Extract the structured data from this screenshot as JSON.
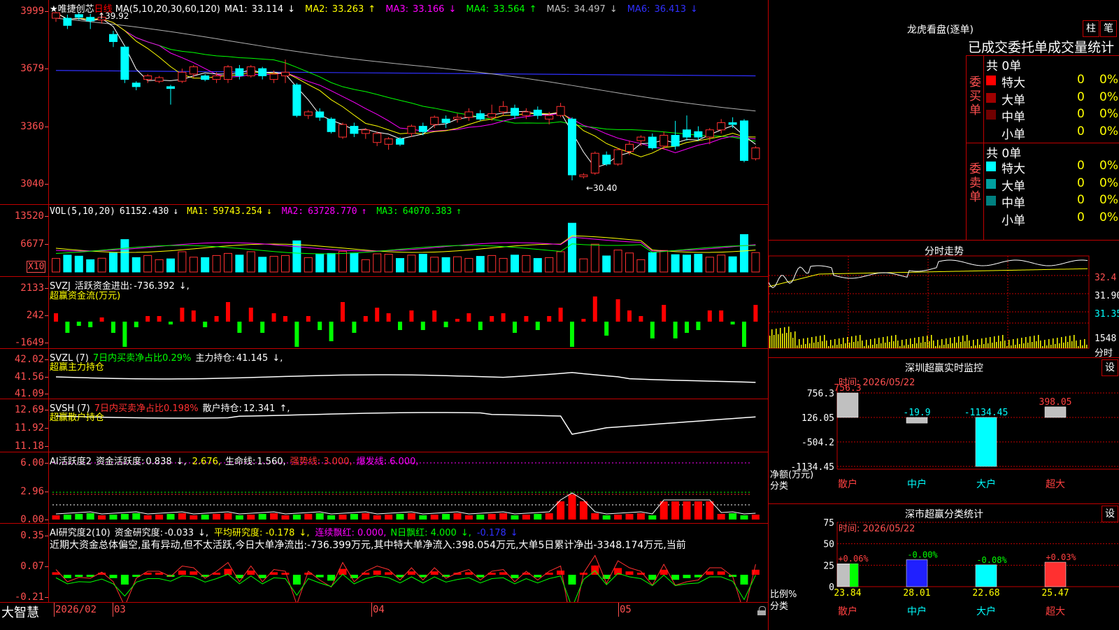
{
  "main": {
    "star": "★",
    "stock_name": "唯捷创芯",
    "period": "日线",
    "ma_label": "MA(5,10,20,30,60,120)",
    "ma": [
      {
        "label": "MA1:",
        "value": "33.114",
        "arrow": "↓",
        "color": "#ffffff"
      },
      {
        "label": "MA2:",
        "value": "33.263",
        "arrow": "↑",
        "color": "#ffff00"
      },
      {
        "label": "MA3:",
        "value": "33.166",
        "arrow": "↓",
        "color": "#ff00ff"
      },
      {
        "label": "MA4:",
        "value": "33.564",
        "arrow": "↑",
        "color": "#00ff00"
      },
      {
        "label": "MA5:",
        "value": "34.497",
        "arrow": "↓",
        "color": "#c0c0c0"
      },
      {
        "label": "MA6:",
        "value": "36.413",
        "arrow": "↓",
        "color": "#3030ff"
      }
    ],
    "yticks": [
      "3999",
      "3679",
      "3360",
      "3040"
    ],
    "high_label": "39.92",
    "low_label": "←30.40"
  },
  "vol": {
    "label": "VOL(5,10,20)",
    "value": "61152.430",
    "value_arrow": "↓",
    "ma": [
      {
        "label": "MA1:",
        "value": "59743.254",
        "arrow": "↓",
        "color": "#ffff00"
      },
      {
        "label": "MA2:",
        "value": "63728.770",
        "arrow": "↑",
        "color": "#ff00ff"
      },
      {
        "label": "MA3:",
        "value": "64070.383",
        "arrow": "↑",
        "color": "#00ff00"
      }
    ],
    "yticks": [
      "13520",
      "6677"
    ],
    "unit": "X10"
  },
  "svzj": {
    "label": "SVZJ",
    "desc": "活跃资金进出:",
    "value": "-736.392",
    "arrow": "↓,",
    "subtitle": "超赢资金流(万元)",
    "yticks": [
      "2133",
      "242",
      "-1649"
    ]
  },
  "svzl": {
    "label": "SVZL (7)",
    "desc": "7日内买卖净占比0.29%",
    "desc2": "主力持仓:",
    "value": "41.145",
    "arrow": "↓,",
    "subtitle": "超赢主力持仓",
    "yticks": [
      "42.02",
      "41.56",
      "41.09"
    ]
  },
  "svsh": {
    "label": "SVSH (7)",
    "desc": "7日内买卖净占比0.198%",
    "desc2": "散户持仓:",
    "value": "12.341",
    "arrow": "↑,",
    "subtitle": "超赢散户持仓",
    "yticks": [
      "12.69",
      "11.92",
      "11.18"
    ]
  },
  "ai": {
    "label": "AI活跃度2",
    "desc": "资金活跃度:",
    "v1": "0.838",
    "a1": "↓,",
    "v2": "2.676,",
    "life_label": "生命线:",
    "life": "1.560,",
    "strong": "强势线: 3.000,",
    "burst": "爆发线: 6.000,",
    "yticks": [
      "6.00",
      "2.96",
      "0.00"
    ]
  },
  "research": {
    "label": "AI研究度2(10)",
    "desc": "资金研究度:",
    "v1": "-0.033",
    "a1": "↓,",
    "avg": "平均研究度: -0.178",
    "avg_arrow": "↓,",
    "red": "连续飘红: 0.000,",
    "nred": "N日飘红: 4.000",
    "nred_arrow": "↓,",
    "last": "-0.178",
    "last_arrow": "↓",
    "comment": "近期大资金总体偏空,虽有异动,但不太活跃,今日大单净流出:-736.399万元,其中特大单净流入:398.054万元,大单5日累计净出-3348.174万元,当前",
    "yticks": [
      "0.35",
      "0.07",
      "-0.21"
    ]
  },
  "bottom": {
    "brand": "大智慧",
    "dates": [
      "2026/02",
      "03",
      "04",
      "05"
    ]
  },
  "dragon": {
    "title": "龙虎看盘(逐单)",
    "btn1": "柱",
    "btn2": "笔",
    "subtitle": "已成交委托单成交量统计",
    "buy_label": "委买单",
    "sell_label": "委卖单",
    "buy_total": "共 0单",
    "sell_total": "共 0单",
    "buy_rows": [
      {
        "name": "特大",
        "count": "0",
        "pct": "0%",
        "color": "#ff0000"
      },
      {
        "name": "大单",
        "count": "0",
        "pct": "0%",
        "color": "#a00000"
      },
      {
        "name": "中单",
        "count": "0",
        "pct": "0%",
        "color": "#700000"
      },
      {
        "name": "小单",
        "count": "0",
        "pct": "0%",
        "color": "#000000"
      }
    ],
    "sell_rows": [
      {
        "name": "特大",
        "count": "0",
        "pct": "0%",
        "color": "#00ffff"
      },
      {
        "name": "大单",
        "count": "0",
        "pct": "0%",
        "color": "#00a0a0"
      },
      {
        "name": "中单",
        "count": "0",
        "pct": "0%",
        "color": "#008080"
      },
      {
        "name": "小单",
        "count": "0",
        "pct": "0%",
        "color": "#000000"
      }
    ]
  },
  "intraday": {
    "title": "分时走势",
    "yticks": [
      "32.4",
      "31.90",
      "31.35"
    ],
    "vol_tick": "1548",
    "vol_label": "分时"
  },
  "monitor": {
    "title": "深圳超赢实时监控",
    "btn": "设",
    "time": "时间: 2026/05/22",
    "yticks": [
      "756.3",
      "126.05",
      "-504.2",
      "-1134.45"
    ],
    "unit": "净额(万元)",
    "axis_label": "分类",
    "categories": [
      "散户",
      "中户",
      "大户",
      "超大"
    ],
    "values": [
      756.3,
      -19.9,
      -1134.45,
      398.05
    ],
    "value_labels": [
      "756.3",
      "-19.9",
      "-1134.45",
      "398.05"
    ]
  },
  "classify": {
    "title": "深市超赢分类统计",
    "btn": "设",
    "time": "时间: 2026/05/22",
    "yticks": [
      "75",
      "50",
      "25",
      "0"
    ],
    "unit": "比例%",
    "axis_label": "分类",
    "categories": [
      "散户",
      "中户",
      "大户",
      "超大"
    ],
    "values": [
      23.84,
      28.01,
      22.68,
      25.47
    ],
    "changes": [
      "+0.06%",
      "-0.00%",
      "-0.08%",
      "+0.03%"
    ],
    "change_colors": [
      "#ff4040",
      "#00ff00",
      "#00ff00",
      "#ff4040"
    ],
    "bar_colors": [
      "#c0c0c0",
      "#2020ff",
      "#00ffff",
      "#ff3030"
    ]
  },
  "chart_data": {
    "type": "candlestick",
    "ylim": [
      3040,
      3999
    ],
    "candles": [
      [
        3960,
        3990,
        3940,
        3995
      ],
      [
        3960,
        3920,
        3900,
        3980
      ],
      [
        3980,
        3965,
        3950,
        3995
      ],
      [
        3965,
        3945,
        3900,
        3985
      ],
      [
        3950,
        3965,
        3930,
        3990
      ],
      [
        3870,
        3830,
        3800,
        3890
      ],
      [
        3800,
        3620,
        3600,
        3810
      ],
      [
        3600,
        3580,
        3560,
        3610
      ],
      [
        3620,
        3640,
        3600,
        3650
      ],
      [
        3610,
        3630,
        3600,
        3640
      ],
      [
        3580,
        3570,
        3480,
        3590
      ],
      [
        3610,
        3660,
        3600,
        3680
      ],
      [
        3650,
        3690,
        3630,
        3700
      ],
      [
        3640,
        3620,
        3610,
        3650
      ],
      [
        3620,
        3640,
        3600,
        3660
      ],
      [
        3620,
        3690,
        3600,
        3700
      ],
      [
        3680,
        3640,
        3620,
        3700
      ],
      [
        3640,
        3690,
        3630,
        3700
      ],
      [
        3680,
        3640,
        3620,
        3690
      ],
      [
        3620,
        3650,
        3600,
        3670
      ],
      [
        3640,
        3660,
        3600,
        3730
      ],
      [
        3590,
        3420,
        3410,
        3600
      ],
      [
        3420,
        3440,
        3400,
        3450
      ],
      [
        3440,
        3410,
        3390,
        3460
      ],
      [
        3400,
        3330,
        3320,
        3410
      ],
      [
        3300,
        3370,
        3290,
        3380
      ],
      [
        3360,
        3320,
        3300,
        3380
      ],
      [
        3320,
        3340,
        3290,
        3350
      ],
      [
        3270,
        3320,
        3250,
        3330
      ],
      [
        3260,
        3290,
        3230,
        3300
      ],
      [
        3290,
        3260,
        3250,
        3300
      ],
      [
        3320,
        3360,
        3300,
        3370
      ],
      [
        3360,
        3330,
        3310,
        3380
      ],
      [
        3370,
        3410,
        3350,
        3420
      ],
      [
        3400,
        3380,
        3350,
        3420
      ],
      [
        3400,
        3410,
        3380,
        3430
      ],
      [
        3410,
        3440,
        3390,
        3460
      ],
      [
        3430,
        3400,
        3390,
        3450
      ],
      [
        3410,
        3430,
        3390,
        3480
      ],
      [
        3440,
        3470,
        3420,
        3500
      ],
      [
        3460,
        3420,
        3400,
        3480
      ],
      [
        3420,
        3440,
        3400,
        3460
      ],
      [
        3450,
        3420,
        3400,
        3470
      ],
      [
        3400,
        3420,
        3370,
        3440
      ],
      [
        3420,
        3470,
        3410,
        3490
      ],
      [
        3400,
        3090,
        3060,
        3410
      ],
      [
        3080,
        3090,
        3070,
        3100
      ],
      [
        3100,
        3210,
        3090,
        3220
      ],
      [
        3200,
        3150,
        3140,
        3220
      ],
      [
        3150,
        3230,
        3140,
        3240
      ],
      [
        3220,
        3260,
        3200,
        3280
      ],
      [
        3280,
        3300,
        3250,
        3310
      ],
      [
        3300,
        3240,
        3230,
        3320
      ],
      [
        3250,
        3310,
        3230,
        3330
      ],
      [
        3310,
        3250,
        3230,
        3390
      ],
      [
        3340,
        3300,
        3280,
        3420
      ],
      [
        3330,
        3300,
        3280,
        3360
      ],
      [
        3300,
        3340,
        3260,
        3350
      ],
      [
        3340,
        3380,
        3320,
        3400
      ],
      [
        3380,
        3370,
        3350,
        3410
      ],
      [
        3390,
        3170,
        3160,
        3400
      ],
      [
        3180,
        3240,
        3170,
        3250
      ]
    ]
  }
}
